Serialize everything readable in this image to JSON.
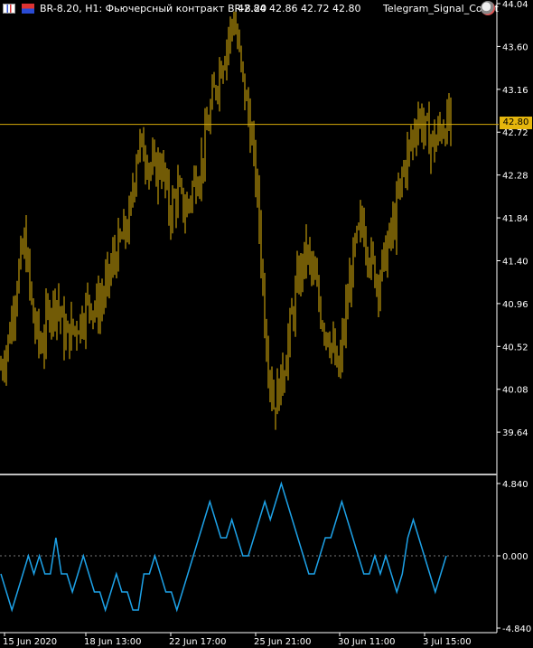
{
  "header": {
    "symbol_title": "BR-8.20, H1:  Фьючерсный контракт BR-8.20",
    "ohlc": "42.84 42.86 42.72 42.80",
    "indicator_name": "Telegram_Signal_Count"
  },
  "icons": {
    "window_flag_1": "window-icon",
    "window_flag_2": "flag-icon",
    "robot": "robot-icon"
  },
  "colors": {
    "background": "#000000",
    "candles": "#e5b60d",
    "current_price_line": "#d4a90a",
    "indicator_line": "#1da2e8",
    "axis_text": "#ffffff",
    "separator": "#bfbfbf"
  },
  "chart_data": [
    {
      "type": "candlestick",
      "title": "",
      "ylim": [
        39.4,
        44.04
      ],
      "y_ticks": [
        "44.04",
        "43.60",
        "43.16",
        "42.72",
        "42.28",
        "41.84",
        "41.40",
        "40.96",
        "40.52",
        "40.08",
        "39.64"
      ],
      "current_price": 42.8,
      "current_price_label": "42.80",
      "x_ticks": [
        "15 Jun 2020",
        "18 Jun 13:00",
        "22 Jun 17:00",
        "25 Jun 21:00",
        "30 Jun 11:00",
        "3 Jul 15:00"
      ],
      "close_path": [
        40.3,
        40.6,
        41.2,
        41.6,
        40.8,
        40.5,
        40.9,
        41.0,
        40.6,
        40.7,
        40.8,
        41.0,
        40.9,
        41.1,
        41.4,
        41.6,
        41.8,
        42.6,
        42.5,
        42.3,
        42.4,
        41.9,
        42.1,
        41.9,
        42.2,
        42.4,
        42.9,
        43.3,
        43.6,
        43.9,
        43.3,
        42.8,
        42.0,
        40.6,
        39.9,
        40.2,
        40.7,
        41.2,
        41.5,
        41.2,
        40.8,
        40.6,
        40.2,
        40.9,
        41.5,
        41.8,
        41.4,
        41.2,
        41.5,
        41.8,
        42.3,
        42.6,
        42.9,
        42.7,
        42.6,
        42.8,
        42.8
      ]
    },
    {
      "type": "line",
      "title": "",
      "series_name": "",
      "ylim": [
        -4.84,
        4.84
      ],
      "y_ticks": [
        "4.840",
        "0.000",
        "-4.840"
      ],
      "values": [
        -1,
        -2,
        -3,
        -2,
        -1,
        0,
        -1,
        0,
        -1,
        -1,
        1,
        -1,
        -1,
        -2,
        -1,
        0,
        -1,
        -2,
        -2,
        -3,
        -2,
        -1,
        -2,
        -2,
        -3,
        -3,
        -1,
        -1,
        0,
        -1,
        -2,
        -2,
        -3,
        -2,
        -1,
        0,
        1,
        2,
        3,
        2,
        1,
        1,
        2,
        1,
        0,
        0,
        1,
        2,
        3,
        2,
        3,
        4,
        3,
        2,
        1,
        0,
        -1,
        -1,
        0,
        1,
        1,
        2,
        3,
        2,
        1,
        0,
        -1,
        -1,
        0,
        -1,
        0,
        -1,
        -2,
        -1,
        1,
        2,
        1,
        0,
        -1,
        -2,
        -1,
        0
      ]
    }
  ]
}
